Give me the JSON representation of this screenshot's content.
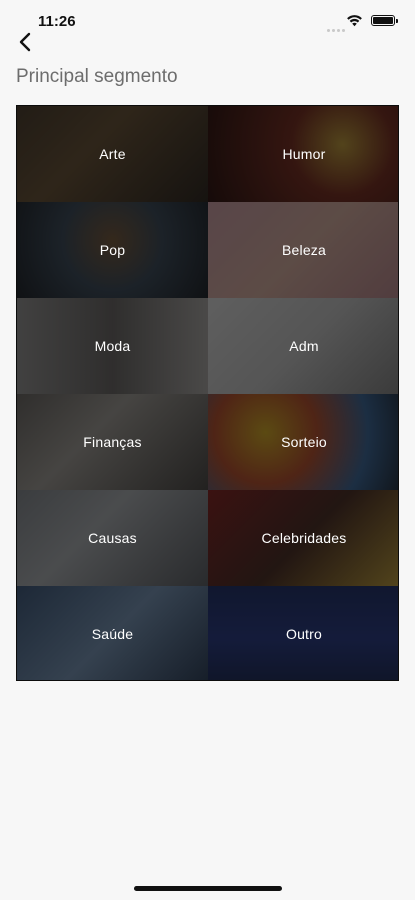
{
  "status_bar": {
    "time": "11:26",
    "signal_icon": "cellular-signal-icon",
    "wifi_icon": "wifi-icon",
    "battery_icon": "battery-icon"
  },
  "nav": {
    "back_icon": "chevron-left-icon"
  },
  "page": {
    "title": "Principal segmento"
  },
  "segments": [
    {
      "label": "Arte",
      "bg": "bg-arte"
    },
    {
      "label": "Humor",
      "bg": "bg-humor"
    },
    {
      "label": "Pop",
      "bg": "bg-pop"
    },
    {
      "label": "Beleza",
      "bg": "bg-beleza"
    },
    {
      "label": "Moda",
      "bg": "bg-moda"
    },
    {
      "label": "Adm",
      "bg": "bg-adm"
    },
    {
      "label": "Finanças",
      "bg": "bg-financas"
    },
    {
      "label": "Sorteio",
      "bg": "bg-sorteio"
    },
    {
      "label": "Causas",
      "bg": "bg-causas"
    },
    {
      "label": "Celebridades",
      "bg": "bg-celebridades"
    },
    {
      "label": "Saúde",
      "bg": "bg-saude"
    },
    {
      "label": "Outro",
      "bg": "bg-outro"
    }
  ],
  "colors": {
    "background": "#f7f7f7",
    "title_text": "#6d6d6d",
    "tile_overlay": "#0a0a0a",
    "tile_text": "#ffffff"
  }
}
